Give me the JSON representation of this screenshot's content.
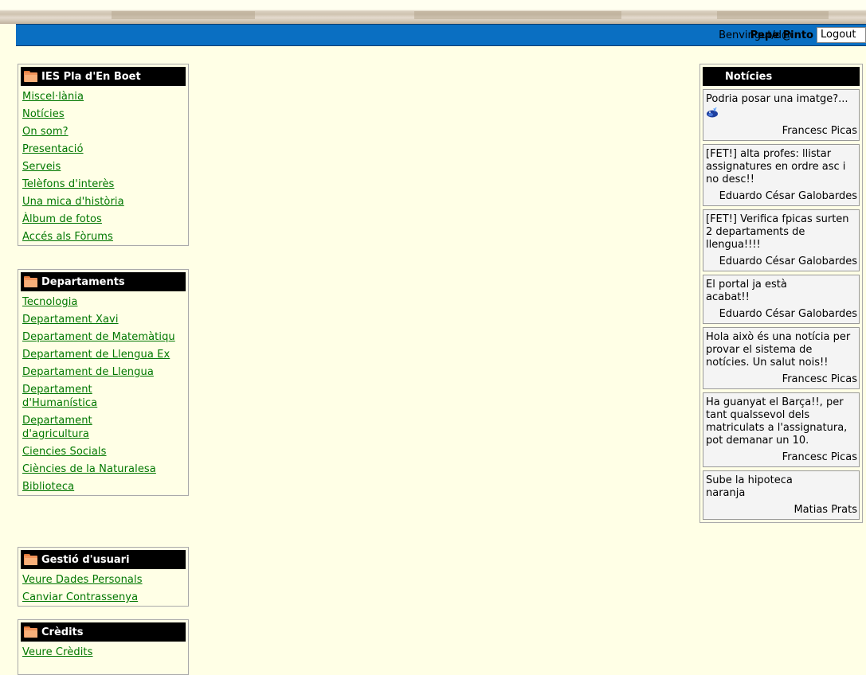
{
  "header": {
    "welcome": "Benvingut/d@",
    "username": "Pepe Pinto",
    "logout_label": "Logout"
  },
  "menus": [
    {
      "title": "IES Pla d'En Boet",
      "items": [
        "Miscel·lània",
        "Notícies",
        "On som?",
        "Presentació",
        "Serveis",
        "Telèfons d'interès",
        "Una mica d'història",
        "Àlbum de fotos",
        "Accés als Fòrums"
      ]
    },
    {
      "title": "Departaments",
      "items": [
        "Tecnologia",
        "Departament Xavi",
        "Departament de Matemàtiqu",
        "Departament de Llengua Ex",
        "Departament de Llengua",
        "Departament d'Humanística",
        "Departament d'agricultura",
        "Ciencies Socials",
        "Ciències de la Naturalesa",
        "Biblioteca"
      ]
    },
    {
      "title": "Gestió d'usuari",
      "items": [
        "Veure Dades Personals",
        "Canviar Contrassenya"
      ]
    },
    {
      "title": "Crèdits",
      "items": [
        "Veure Crèdits"
      ]
    }
  ],
  "news": {
    "title": "Notícies",
    "items": [
      {
        "text": "Podria posar una imatge?...",
        "author": "Francesc Picas",
        "icon": "whale-icon"
      },
      {
        "text": "[FET!] alta profes: llistar assignatures en ordre asc i no desc!!",
        "author": "Eduardo César Galobardes"
      },
      {
        "text": "[FET!] Verifica fpicas surten 2 departaments de llengua!!!!",
        "author": "Eduardo César Galobardes"
      },
      {
        "text": "El portal ja està acabat!!",
        "author": "Eduardo César Galobardes"
      },
      {
        "text": "Hola això és una notícia per provar el sistema de notícies. Un salut nois!!",
        "author": "Francesc Picas"
      },
      {
        "text": "Ha guanyat el Barça!!, per tant qualssevol dels matriculats a l'assignatura, pot demanar un 10.",
        "author": "Francesc Picas"
      },
      {
        "text": "Sube la hipoteca naranja",
        "author": "Matias Prats"
      }
    ]
  },
  "colors": {
    "background": "#FFFFE6",
    "topbar": "#0A6FC2",
    "link": "#007700",
    "box_title": "#000000"
  }
}
